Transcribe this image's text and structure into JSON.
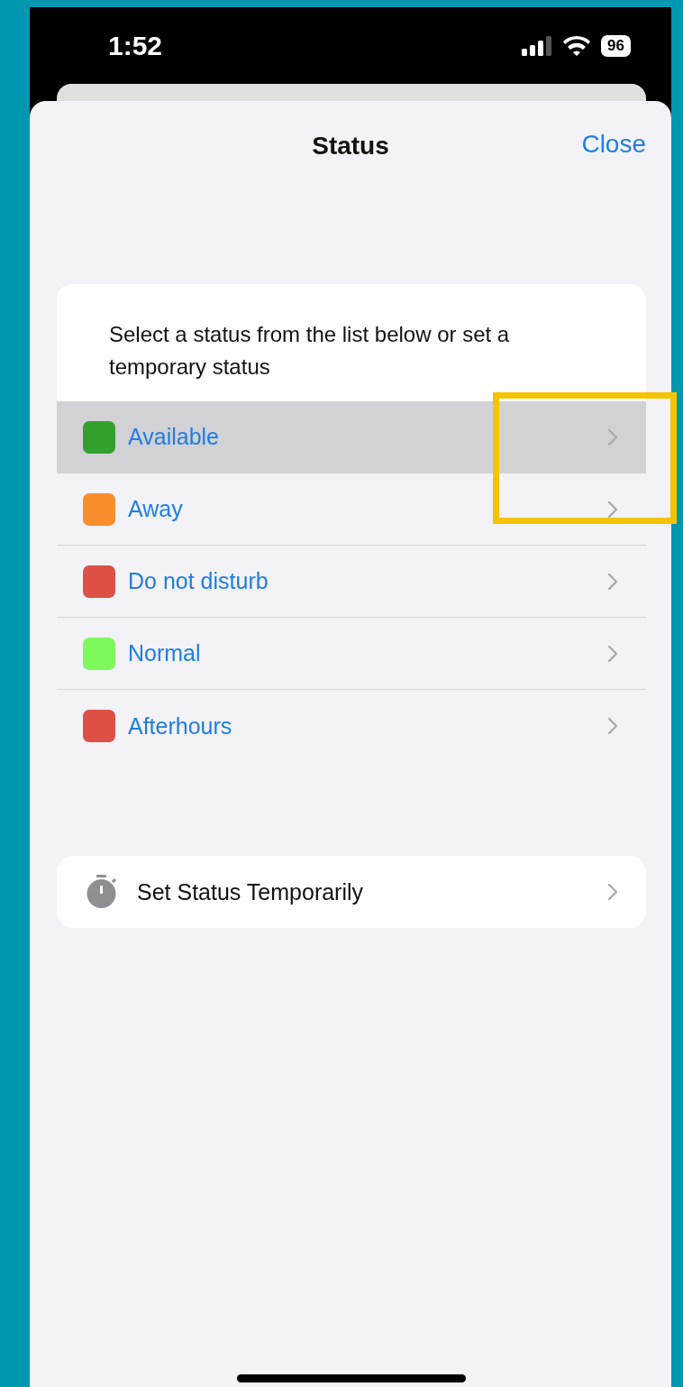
{
  "status_bar": {
    "time": "1:52",
    "battery": "96"
  },
  "header": {
    "title": "Status",
    "close": "Close"
  },
  "description": "Select a status from the list below or set a temporary status",
  "statuses": [
    {
      "label": "Available",
      "color": "#33a02c",
      "selected": true
    },
    {
      "label": "Away",
      "color": "#f98f2c",
      "selected": false
    },
    {
      "label": "Do not disturb",
      "color": "#dc5045",
      "selected": false
    },
    {
      "label": "Normal",
      "color": "#7ef95c",
      "selected": false
    },
    {
      "label": "Afterhours",
      "color": "#dc5045",
      "selected": false
    }
  ],
  "temporary": {
    "label": "Set Status Temporarily"
  }
}
